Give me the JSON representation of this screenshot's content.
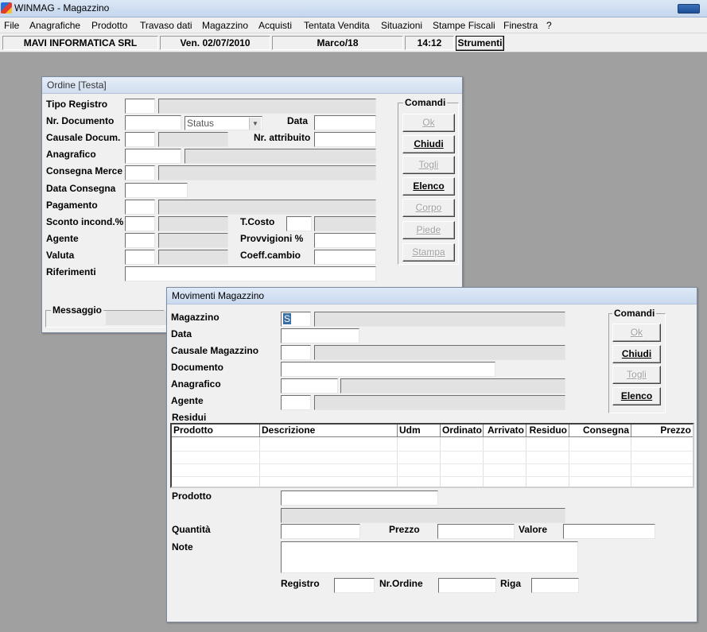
{
  "window": {
    "title": "WINMAG - Magazzino"
  },
  "menu": [
    "File",
    "Anagrafiche",
    "Prodotto",
    "Travaso dati",
    "Magazzino",
    "Acquisti",
    "Tentata Vendita",
    "Situazioni",
    "Stampe Fiscali",
    "Finestra",
    "?"
  ],
  "status": {
    "company": "MAVI INFORMATICA SRL",
    "date": "Ven. 02/07/2010",
    "user": "Marco/18",
    "time": "14:12",
    "tools_label": "Strumenti"
  },
  "ordine": {
    "title": "Ordine [Testa]",
    "labels": {
      "tipo_registro": "Tipo Registro",
      "nr_documento": "Nr. Documento",
      "data": "Data",
      "causale_docum": "Causale Docum.",
      "nr_attribuito": "Nr. attribuito",
      "anagrafico": "Anagrafico",
      "consegna_merce": "Consegna Merce",
      "data_consegna": "Data Consegna",
      "pagamento": "Pagamento",
      "sconto": "Sconto incond.%",
      "t_costo": "T.Costo",
      "agente": "Agente",
      "provvigioni": "Provvigioni %",
      "valuta": "Valuta",
      "coeff_cambio": "Coeff.cambio",
      "riferimenti": "Riferimenti",
      "messaggio": "Messaggio"
    },
    "status_combo": "Status",
    "comandi_title": "Comandi",
    "buttons": {
      "ok": "Ok",
      "chiudi": "Chiudi",
      "togli": "Togli",
      "elenco": "Elenco",
      "corpo": "Corpo",
      "piede": "Piede",
      "stampa": "Stampa"
    }
  },
  "movimenti": {
    "title": "Movimenti Magazzino",
    "labels": {
      "magazzino": "Magazzino",
      "data": "Data",
      "causale": "Causale Magazzino",
      "documento": "Documento",
      "anagrafico": "Anagrafico",
      "agente": "Agente",
      "residui": "Residui",
      "prodotto": "Prodotto",
      "quantita": "Quantità",
      "prezzo": "Prezzo",
      "valore": "Valore",
      "note": "Note",
      "registro": "Registro",
      "nr_ordine": "Nr.Ordine",
      "riga": "Riga"
    },
    "magazzino_value": "S",
    "comandi_title": "Comandi",
    "buttons": {
      "ok": "Ok",
      "chiudi": "Chiudi",
      "togli": "Togli",
      "elenco": "Elenco"
    },
    "columns": [
      "Prodotto",
      "Descrizione",
      "Udm",
      "Ordinato",
      "Arrivato",
      "Residuo",
      "Consegna",
      "Prezzo"
    ]
  }
}
